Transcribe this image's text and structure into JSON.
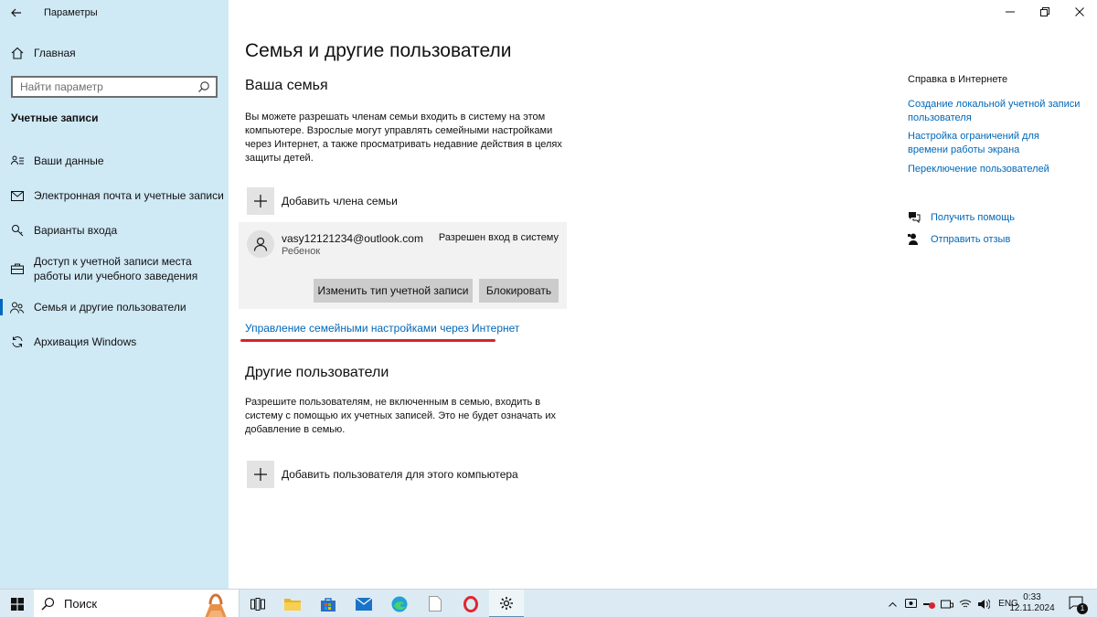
{
  "window": {
    "title": "Параметры"
  },
  "sidebar": {
    "home_label": "Главная",
    "search_placeholder": "Найти параметр",
    "section_title": "Учетные записи",
    "items": [
      {
        "label": "Ваши данные",
        "icon": "person-list-icon"
      },
      {
        "label": "Электронная почта и учетные записи",
        "icon": "mail-icon"
      },
      {
        "label": "Варианты входа",
        "icon": "key-icon"
      },
      {
        "label": "Доступ к учетной записи места работы или учебного заведения",
        "icon": "briefcase-icon"
      },
      {
        "label": "Семья и другие пользователи",
        "icon": "people-icon",
        "active": true
      },
      {
        "label": "Архивация Windows",
        "icon": "sync-icon"
      }
    ]
  },
  "main": {
    "title": "Семья и другие пользователи",
    "family": {
      "heading": "Ваша семья",
      "description": "Вы можете разрешать членам семьи входить в систему на этом компьютере. Взрослые могут управлять семейными настройками через Интернет, а также просматривать недавние действия в целях защиты детей.",
      "add_label": "Добавить члена семьи",
      "member": {
        "email": "vasy12121234@outlook.com",
        "role": "Ребенок",
        "status": "Разрешен вход в систему",
        "change_type_label": "Изменить тип учетной записи",
        "block_label": "Блокировать"
      },
      "manage_link": "Управление семейными настройками через Интернет"
    },
    "others": {
      "heading": "Другие пользователи",
      "description": "Разрешите пользователям, не включенным в семью, входить в систему с помощью их учетных записей. Это не будет означать их добавление в семью.",
      "add_label": "Добавить пользователя для этого компьютера"
    }
  },
  "right": {
    "heading": "Справка в Интернете",
    "links": [
      "Создание локальной учетной записи пользователя",
      "Настройка ограничений для времени работы экрана",
      "Переключение пользователей"
    ],
    "help_label": "Получить помощь",
    "feedback_label": "Отправить отзыв"
  },
  "taskbar": {
    "search_label": "Поиск",
    "language": "ENG",
    "time": "0:33",
    "date": "12.11.2024",
    "notification_count": "1"
  },
  "colors": {
    "accent": "#0067b8",
    "sidebar_bg": "#cfe9f5",
    "highlight": "#d9232e"
  }
}
